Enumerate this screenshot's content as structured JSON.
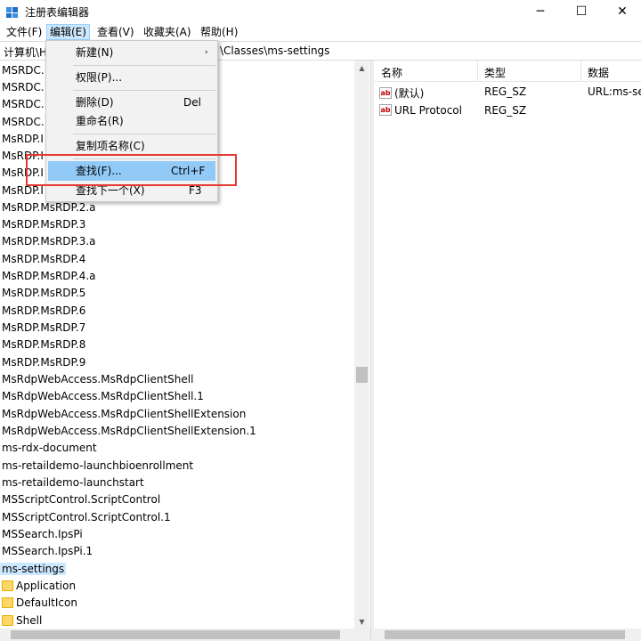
{
  "window": {
    "title": "注册表编辑器",
    "controls": {
      "minimize": "─",
      "maximize": "☐",
      "close": "✕"
    }
  },
  "menubar": [
    {
      "label": "文件(F)"
    },
    {
      "label": "编辑(E)"
    },
    {
      "label": "查看(V)"
    },
    {
      "label": "收藏夹(A)"
    },
    {
      "label": "帮助(H)"
    }
  ],
  "addressbar": {
    "left": "计算机\\H",
    "right": "\\Classes\\ms-settings"
  },
  "edit_menu": {
    "items": [
      {
        "label": "新建(N)",
        "shortcut": "",
        "arrow": "›"
      },
      {
        "label": "权限(P)...",
        "shortcut": ""
      },
      {
        "label": "删除(D)",
        "shortcut": "Del"
      },
      {
        "label": "重命名(R)",
        "shortcut": ""
      },
      {
        "label": "复制项名称(C)",
        "shortcut": ""
      },
      {
        "label": "查找(F)...",
        "shortcut": "Ctrl+F"
      },
      {
        "label": "查找下一个(X)",
        "shortcut": "F3"
      }
    ]
  },
  "tree": {
    "items": [
      "MSRDC.",
      "MSRDC.",
      "MSRDC.",
      "MSRDC.",
      "MsRDP.I",
      "MsRDP.I",
      "MsRDP.I",
      "MsRDP.I",
      "MsRDP.MsRDP.2.a",
      "MsRDP.MsRDP.3",
      "MsRDP.MsRDP.3.a",
      "MsRDP.MsRDP.4",
      "MsRDP.MsRDP.4.a",
      "MsRDP.MsRDP.5",
      "MsRDP.MsRDP.6",
      "MsRDP.MsRDP.7",
      "MsRDP.MsRDP.8",
      "MsRDP.MsRDP.9",
      "MsRdpWebAccess.MsRdpClientShell",
      "MsRdpWebAccess.MsRdpClientShell.1",
      "MsRdpWebAccess.MsRdpClientShellExtension",
      "MsRdpWebAccess.MsRdpClientShellExtension.1",
      "ms-rdx-document",
      "ms-retaildemo-launchbioenrollment",
      "ms-retaildemo-launchstart",
      "MSScriptControl.ScriptControl",
      "MSScriptControl.ScriptControl.1",
      "MSSearch.IpsPi",
      "MSSearch.IpsPi.1",
      "ms-settings"
    ],
    "children": [
      "Application",
      "DefaultIcon",
      "Shell"
    ]
  },
  "list": {
    "headers": {
      "name": "名称",
      "type": "类型",
      "data": "数据"
    },
    "rows": [
      {
        "name": "(默认)",
        "type": "REG_SZ",
        "data": "URL:ms-se"
      },
      {
        "name": "URL Protocol",
        "type": "REG_SZ",
        "data": ""
      }
    ]
  },
  "colors": {
    "accent": "#0078d7",
    "selection": "#cce8ff",
    "menu_highlight": "#91c9f7",
    "annotation": "#e53935"
  }
}
